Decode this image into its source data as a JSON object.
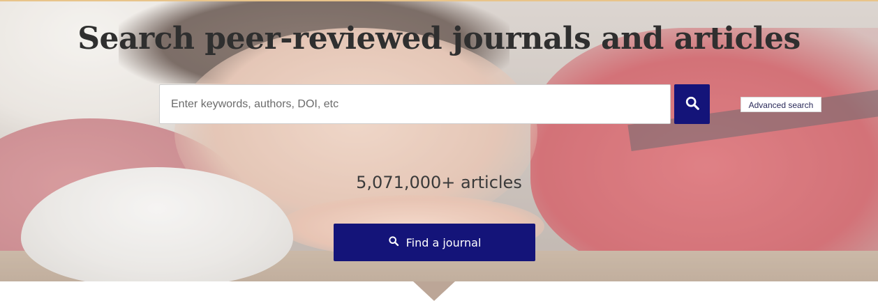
{
  "hero": {
    "title": "Search peer-reviewed journals and articles",
    "search": {
      "placeholder": "Enter keywords, authors, DOI, etc",
      "value": ""
    },
    "search_button_icon": "search-icon",
    "advanced_search_label": "Advanced search",
    "article_count": "5,071,000+ articles",
    "find_journal": {
      "label": "Find a journal",
      "icon": "search-icon"
    }
  },
  "colors": {
    "primary": "#141479",
    "accent_line": "#e8c48a",
    "title_text": "#2f2f2f"
  }
}
